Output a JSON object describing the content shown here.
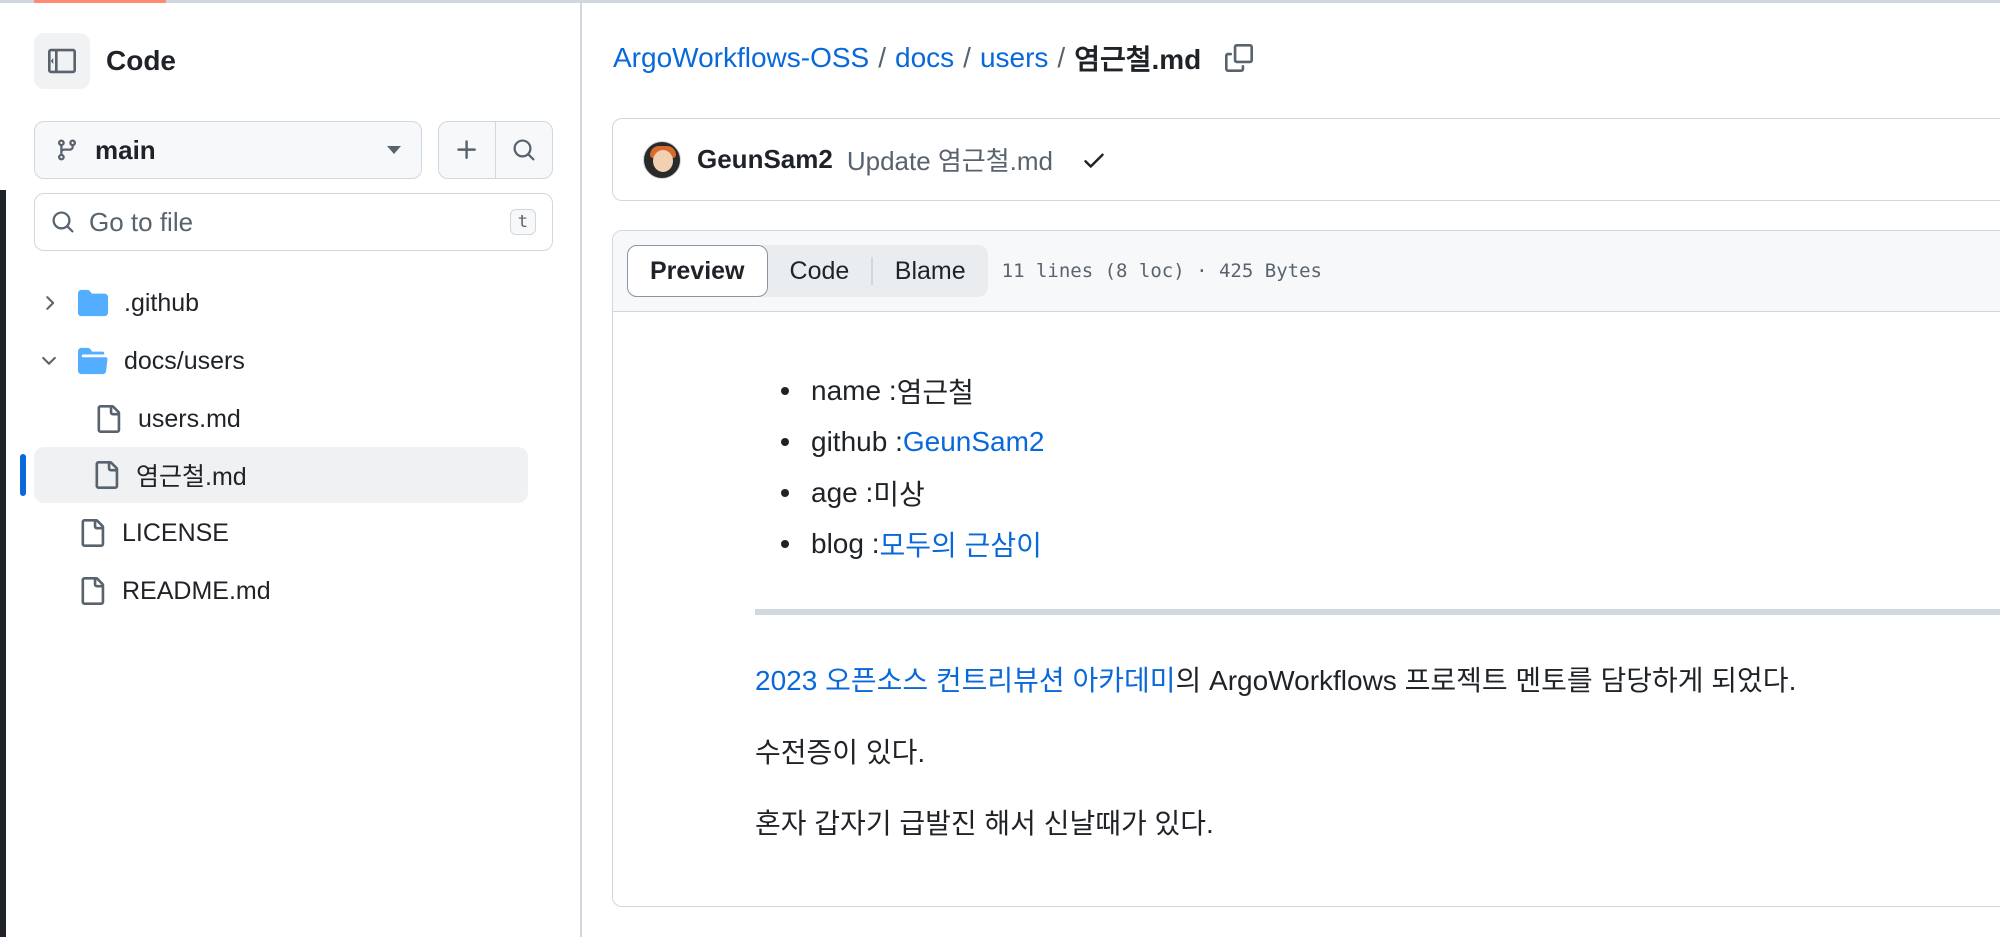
{
  "sidebar": {
    "title": "Code",
    "branch": "main",
    "search_placeholder": "Go to file",
    "search_shortcut": "t",
    "tree": [
      {
        "label": ".github",
        "type": "folder",
        "expanded": false
      },
      {
        "label": "docs/users",
        "type": "folder",
        "expanded": true
      },
      {
        "label": "users.md",
        "type": "file"
      },
      {
        "label": "염근철.md",
        "type": "file",
        "selected": true
      },
      {
        "label": "LICENSE",
        "type": "file"
      },
      {
        "label": "README.md",
        "type": "file"
      }
    ]
  },
  "breadcrumb": {
    "repo": "ArgoWorkflows-OSS",
    "dir1": "docs",
    "dir2": "users",
    "file": "염근철.md",
    "sep": "/"
  },
  "commit": {
    "author": "GeunSam2",
    "message": "Update 염근철.md"
  },
  "file_view": {
    "tabs": [
      "Preview",
      "Code",
      "Blame"
    ],
    "active_tab": "Preview",
    "meta": "11 lines (8 loc) · 425 Bytes"
  },
  "content": {
    "items": [
      {
        "key": "name : ",
        "value": "염근철",
        "link": false
      },
      {
        "key": "github : ",
        "value": "GeunSam2",
        "link": true
      },
      {
        "key": "age : ",
        "value": "미상",
        "link": false
      },
      {
        "key": "blog : ",
        "value": "모두의 근삼이",
        "link": true
      }
    ],
    "p1_link": "2023 오픈소스 컨트리뷰션 아카데미",
    "p1_rest": "의 ArgoWorkflows 프로젝트 멘토를 담당하게 되었다.",
    "p2": "수전증이 있다.",
    "p3": "혼자 갑자기 급발진 해서 신날때가 있다."
  },
  "colors": {
    "link": "#0969da",
    "border": "#d0d7de",
    "selected_bar": "#0969da",
    "folder": "#54aeff"
  }
}
